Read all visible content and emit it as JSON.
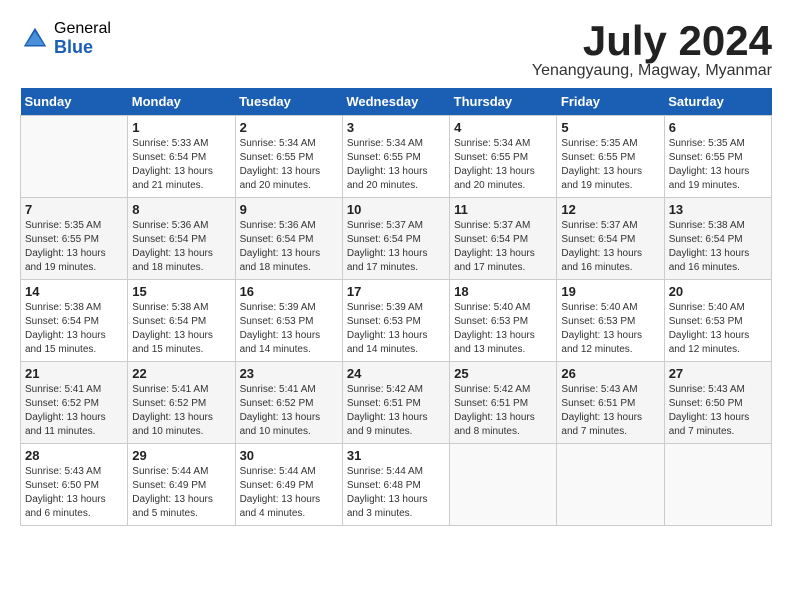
{
  "header": {
    "logo_general": "General",
    "logo_blue": "Blue",
    "title": "July 2024",
    "subtitle": "Yenangyaung, Magway, Myanmar"
  },
  "weekdays": [
    "Sunday",
    "Monday",
    "Tuesday",
    "Wednesday",
    "Thursday",
    "Friday",
    "Saturday"
  ],
  "weeks": [
    [
      {
        "day": "",
        "info": ""
      },
      {
        "day": "1",
        "info": "Sunrise: 5:33 AM\nSunset: 6:54 PM\nDaylight: 13 hours\nand 21 minutes."
      },
      {
        "day": "2",
        "info": "Sunrise: 5:34 AM\nSunset: 6:55 PM\nDaylight: 13 hours\nand 20 minutes."
      },
      {
        "day": "3",
        "info": "Sunrise: 5:34 AM\nSunset: 6:55 PM\nDaylight: 13 hours\nand 20 minutes."
      },
      {
        "day": "4",
        "info": "Sunrise: 5:34 AM\nSunset: 6:55 PM\nDaylight: 13 hours\nand 20 minutes."
      },
      {
        "day": "5",
        "info": "Sunrise: 5:35 AM\nSunset: 6:55 PM\nDaylight: 13 hours\nand 19 minutes."
      },
      {
        "day": "6",
        "info": "Sunrise: 5:35 AM\nSunset: 6:55 PM\nDaylight: 13 hours\nand 19 minutes."
      }
    ],
    [
      {
        "day": "7",
        "info": "Sunrise: 5:35 AM\nSunset: 6:55 PM\nDaylight: 13 hours\nand 19 minutes."
      },
      {
        "day": "8",
        "info": "Sunrise: 5:36 AM\nSunset: 6:54 PM\nDaylight: 13 hours\nand 18 minutes."
      },
      {
        "day": "9",
        "info": "Sunrise: 5:36 AM\nSunset: 6:54 PM\nDaylight: 13 hours\nand 18 minutes."
      },
      {
        "day": "10",
        "info": "Sunrise: 5:37 AM\nSunset: 6:54 PM\nDaylight: 13 hours\nand 17 minutes."
      },
      {
        "day": "11",
        "info": "Sunrise: 5:37 AM\nSunset: 6:54 PM\nDaylight: 13 hours\nand 17 minutes."
      },
      {
        "day": "12",
        "info": "Sunrise: 5:37 AM\nSunset: 6:54 PM\nDaylight: 13 hours\nand 16 minutes."
      },
      {
        "day": "13",
        "info": "Sunrise: 5:38 AM\nSunset: 6:54 PM\nDaylight: 13 hours\nand 16 minutes."
      }
    ],
    [
      {
        "day": "14",
        "info": "Sunrise: 5:38 AM\nSunset: 6:54 PM\nDaylight: 13 hours\nand 15 minutes."
      },
      {
        "day": "15",
        "info": "Sunrise: 5:38 AM\nSunset: 6:54 PM\nDaylight: 13 hours\nand 15 minutes."
      },
      {
        "day": "16",
        "info": "Sunrise: 5:39 AM\nSunset: 6:53 PM\nDaylight: 13 hours\nand 14 minutes."
      },
      {
        "day": "17",
        "info": "Sunrise: 5:39 AM\nSunset: 6:53 PM\nDaylight: 13 hours\nand 14 minutes."
      },
      {
        "day": "18",
        "info": "Sunrise: 5:40 AM\nSunset: 6:53 PM\nDaylight: 13 hours\nand 13 minutes."
      },
      {
        "day": "19",
        "info": "Sunrise: 5:40 AM\nSunset: 6:53 PM\nDaylight: 13 hours\nand 12 minutes."
      },
      {
        "day": "20",
        "info": "Sunrise: 5:40 AM\nSunset: 6:53 PM\nDaylight: 13 hours\nand 12 minutes."
      }
    ],
    [
      {
        "day": "21",
        "info": "Sunrise: 5:41 AM\nSunset: 6:52 PM\nDaylight: 13 hours\nand 11 minutes."
      },
      {
        "day": "22",
        "info": "Sunrise: 5:41 AM\nSunset: 6:52 PM\nDaylight: 13 hours\nand 10 minutes."
      },
      {
        "day": "23",
        "info": "Sunrise: 5:41 AM\nSunset: 6:52 PM\nDaylight: 13 hours\nand 10 minutes."
      },
      {
        "day": "24",
        "info": "Sunrise: 5:42 AM\nSunset: 6:51 PM\nDaylight: 13 hours\nand 9 minutes."
      },
      {
        "day": "25",
        "info": "Sunrise: 5:42 AM\nSunset: 6:51 PM\nDaylight: 13 hours\nand 8 minutes."
      },
      {
        "day": "26",
        "info": "Sunrise: 5:43 AM\nSunset: 6:51 PM\nDaylight: 13 hours\nand 7 minutes."
      },
      {
        "day": "27",
        "info": "Sunrise: 5:43 AM\nSunset: 6:50 PM\nDaylight: 13 hours\nand 7 minutes."
      }
    ],
    [
      {
        "day": "28",
        "info": "Sunrise: 5:43 AM\nSunset: 6:50 PM\nDaylight: 13 hours\nand 6 minutes."
      },
      {
        "day": "29",
        "info": "Sunrise: 5:44 AM\nSunset: 6:49 PM\nDaylight: 13 hours\nand 5 minutes."
      },
      {
        "day": "30",
        "info": "Sunrise: 5:44 AM\nSunset: 6:49 PM\nDaylight: 13 hours\nand 4 minutes."
      },
      {
        "day": "31",
        "info": "Sunrise: 5:44 AM\nSunset: 6:48 PM\nDaylight: 13 hours\nand 3 minutes."
      },
      {
        "day": "",
        "info": ""
      },
      {
        "day": "",
        "info": ""
      },
      {
        "day": "",
        "info": ""
      }
    ]
  ]
}
